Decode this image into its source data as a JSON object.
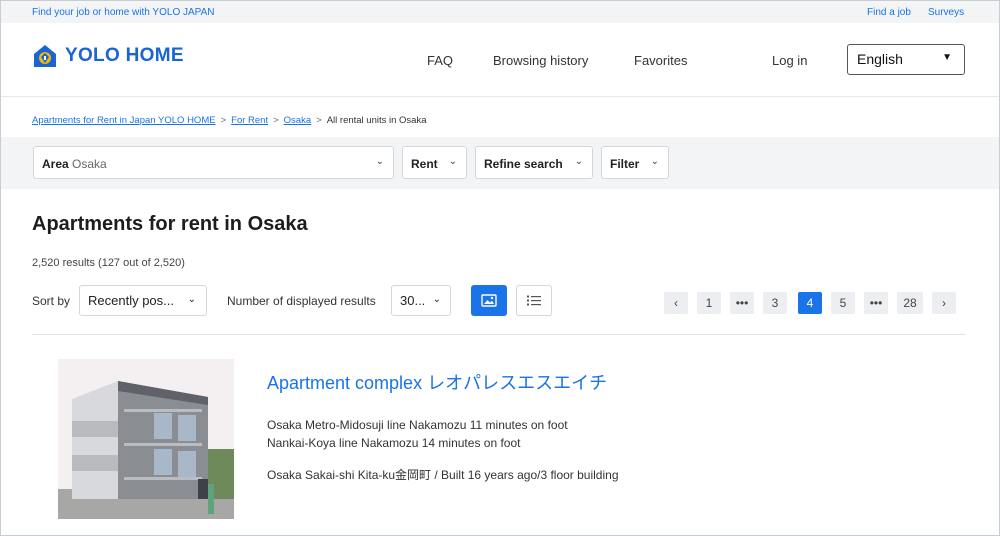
{
  "topbar": {
    "tagline": "Find your job or home with YOLO JAPAN",
    "links": [
      "Find a job",
      "Surveys"
    ]
  },
  "header": {
    "brand": "YOLO HOME",
    "nav": [
      "FAQ",
      "Browsing history",
      "Favorites",
      "Log in"
    ],
    "language": "English"
  },
  "breadcrumb": {
    "links": [
      "Apartments for Rent in Japan YOLO HOME",
      "For Rent",
      "Osaka"
    ],
    "current": "All rental units in Osaka",
    "separator": ">"
  },
  "filters": {
    "area_label": "Area",
    "area_value": "Osaka",
    "rent": "Rent",
    "refine": "Refine search",
    "filter": "Filter"
  },
  "results": {
    "title": "Apartments for rent in Osaka",
    "count": "2,520 results (127 out of 2,520)",
    "sort_label": "Sort by",
    "sort_value": "Recently pos...",
    "num_label": "Number of displayed results",
    "num_value": "30..."
  },
  "pagination": {
    "prev": "‹",
    "pages": [
      "1",
      "•••",
      "3",
      "4",
      "5",
      "•••",
      "28"
    ],
    "current": "4",
    "next": "›"
  },
  "listing": {
    "title": "Apartment complex レオパレスエスエイチ",
    "access": [
      "Osaka Metro-Midosuji line Nakamozu 11 minutes on foot",
      "Nankai-Koya line Nakamozu 14 minutes on foot"
    ],
    "address": "Osaka Sakai-shi Kita-ku金岡町 / Built 16 years ago/3 floor building"
  },
  "colors": {
    "accent": "#1a73e8",
    "brand": "#1a64d6",
    "logo_yellow": "#f5b800",
    "band": "#f3f4f6"
  },
  "icons": {
    "chevron": "chevron-down-icon",
    "grid_view": "image-view-icon",
    "list_view": "list-view-icon"
  }
}
